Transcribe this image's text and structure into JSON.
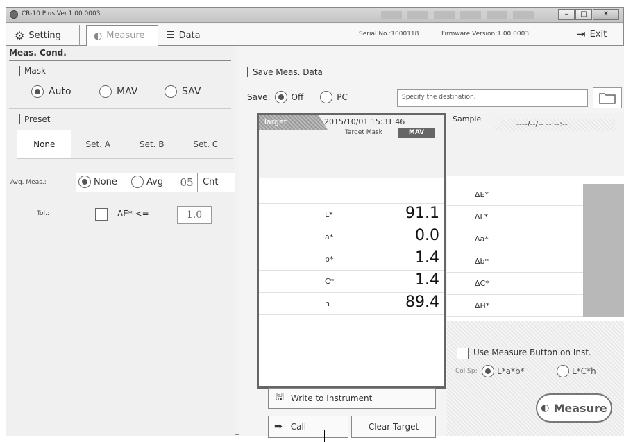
{
  "window": {
    "title": "CR-10 Plus Ver.1.00.0003"
  },
  "toolbar": {
    "setting_label": "Setting",
    "measure_label": "Measure",
    "data_label": "Data",
    "serial": "Serial No.:1000118",
    "firmware": "Firmware Version:1.00.0003",
    "exit_label": "Exit"
  },
  "left": {
    "meas_cond": "Meas. Cond.",
    "mask_title": "Mask",
    "mask_options": [
      "Auto",
      "MAV",
      "SAV"
    ],
    "mask_selected": "Auto",
    "preset_title": "Preset",
    "preset_tabs": [
      "None",
      "Set. A",
      "Set. B",
      "Set. C"
    ],
    "preset_selected": "None",
    "avg_label": "Avg. Meas.:",
    "avg_none": "None",
    "avg_avg": "Avg",
    "avg_count": "05",
    "avg_unit": "Cnt",
    "tol_label": "Tol.:",
    "tol_expr": "ΔE* <=",
    "tol_value": "1.0"
  },
  "save": {
    "title": "Save Meas. Data",
    "save_label": "Save:",
    "off_label": "Off",
    "pc_label": "PC",
    "dest_placeholder": "Specify the destination."
  },
  "target": {
    "tag": "Target",
    "datetime": "2015/10/01 15:31:46",
    "mask_label": "Target Mask",
    "mask_value": "MAV",
    "rows": [
      {
        "label": "L*",
        "value": "91.1"
      },
      {
        "label": "a*",
        "value": "0.0"
      },
      {
        "label": "b*",
        "value": "1.4"
      },
      {
        "label": "C*",
        "value": "1.4"
      },
      {
        "label": "h",
        "value": "89.4"
      }
    ]
  },
  "sample": {
    "tag": "Sample",
    "datetime": "----/--/-- --:--:--",
    "rows": [
      "ΔE*",
      "ΔL*",
      "Δa*",
      "Δb*",
      "ΔC*",
      "ΔH*"
    ]
  },
  "options": {
    "use_measure_button": "Use Measure Button on Inst.",
    "col_sp_label": "Col.Sp:",
    "col_sp_lab": "L*a*b*",
    "col_sp_lch": "L*C*h"
  },
  "buttons": {
    "write": "Write to Instrument",
    "call": "Call",
    "clear": "Clear Target",
    "measure": "Measure"
  }
}
